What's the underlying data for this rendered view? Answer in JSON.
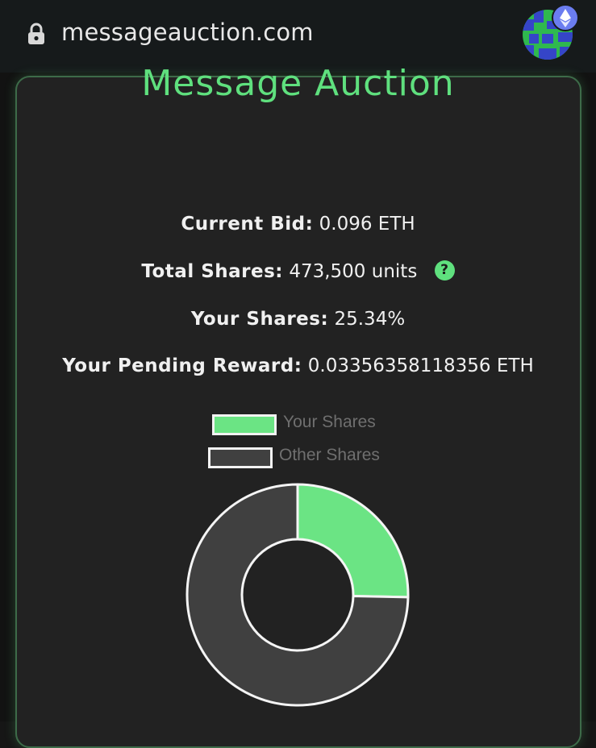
{
  "browser": {
    "url": "messageauction.com"
  },
  "colors": {
    "accent": "#5fe07e",
    "card_bg": "#222222",
    "other_shares": "#404040"
  },
  "main": {
    "title": "Message Auction",
    "stats": [
      {
        "label": "Current Bid:",
        "value": "0.096 ETH"
      },
      {
        "label": "Total Shares:",
        "value": "473,500 units"
      },
      {
        "label": "Your Shares:",
        "value": "25.34%"
      },
      {
        "label": "Your Pending Reward:",
        "value": "0.03356358118356 ETH"
      }
    ],
    "help_icon_text": "?"
  },
  "chart_data": {
    "type": "pie",
    "categories": [
      "Your Shares",
      "Other Shares"
    ],
    "values": [
      25.34,
      74.66
    ],
    "colors": [
      "#6be484",
      "#404040"
    ],
    "legend_placement": "top"
  }
}
